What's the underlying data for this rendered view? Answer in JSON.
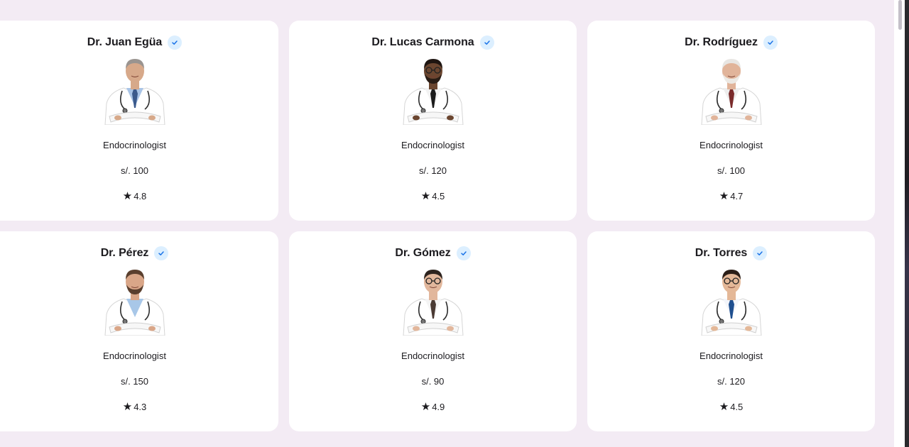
{
  "doctors": [
    {
      "name": "Dr. Juan Egüa",
      "specialty": "Endocrinologist",
      "price": "s/. 100",
      "rating": "4.8",
      "variant": "gray-hair-tie"
    },
    {
      "name": "Dr. Lucas Carmona",
      "specialty": "Endocrinologist",
      "price": "s/. 120",
      "rating": "4.5",
      "variant": "glasses-dark"
    },
    {
      "name": "Dr. Rodríguez",
      "specialty": "Endocrinologist",
      "price": "s/. 100",
      "rating": "4.7",
      "variant": "white-hair"
    },
    {
      "name": "Dr. Pérez",
      "specialty": "Endocrinologist",
      "price": "s/. 150",
      "rating": "4.3",
      "variant": "beard"
    },
    {
      "name": "Dr. Gómez",
      "specialty": "Endocrinologist",
      "price": "s/. 90",
      "rating": "4.9",
      "variant": "glasses-tie"
    },
    {
      "name": "Dr. Torres",
      "specialty": "Endocrinologist",
      "price": "s/. 120",
      "rating": "4.5",
      "variant": "young-blue-tie"
    }
  ],
  "icons": {
    "verified": "verified-check-icon",
    "rating": "star-icon",
    "photo": "doctor-photo"
  },
  "colors": {
    "background": "#f3ebf4",
    "card": "#ffffff",
    "verified_badge": "#dcefff",
    "verified_check": "#1a73e8",
    "text": "#1c1b1f"
  }
}
